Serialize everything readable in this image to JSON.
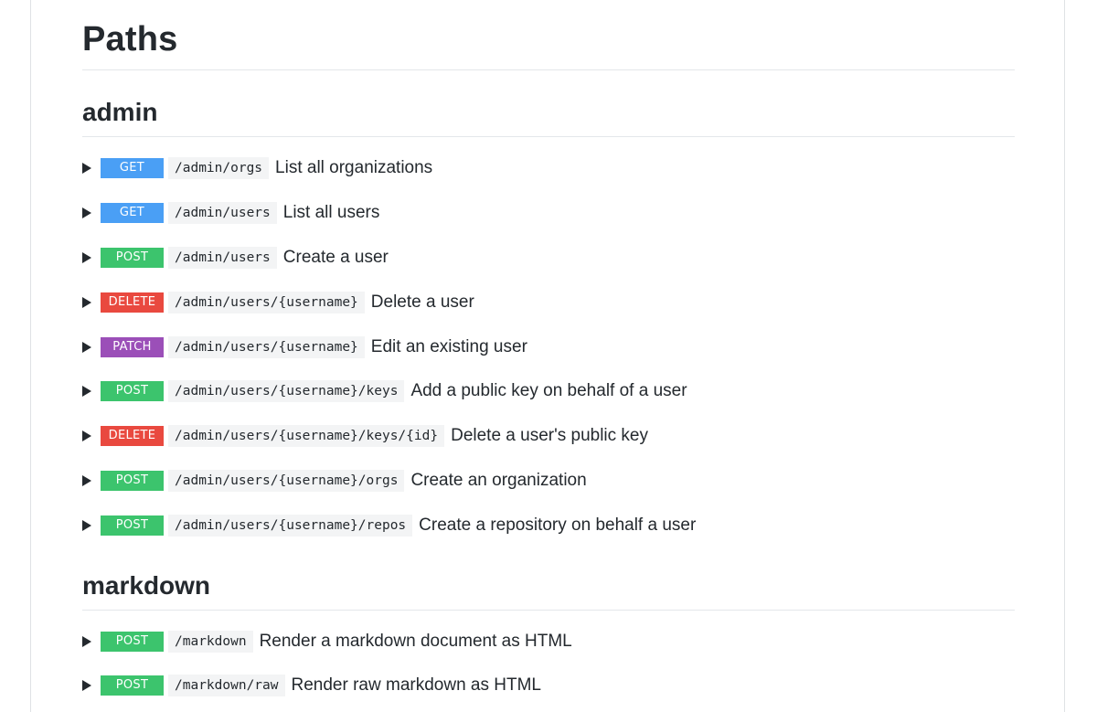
{
  "page": {
    "title": "Paths"
  },
  "sections": [
    {
      "title": "admin",
      "operations": [
        {
          "method": "GET",
          "path": "/admin/orgs",
          "summary": "List all organizations"
        },
        {
          "method": "GET",
          "path": "/admin/users",
          "summary": "List all users"
        },
        {
          "method": "POST",
          "path": "/admin/users",
          "summary": "Create a user"
        },
        {
          "method": "DELETE",
          "path": "/admin/users/{username}",
          "summary": "Delete a user"
        },
        {
          "method": "PATCH",
          "path": "/admin/users/{username}",
          "summary": "Edit an existing user"
        },
        {
          "method": "POST",
          "path": "/admin/users/{username}/keys",
          "summary": "Add a public key on behalf of a user"
        },
        {
          "method": "DELETE",
          "path": "/admin/users/{username}/keys/{id}",
          "summary": "Delete a user's public key"
        },
        {
          "method": "POST",
          "path": "/admin/users/{username}/orgs",
          "summary": "Create an organization"
        },
        {
          "method": "POST",
          "path": "/admin/users/{username}/repos",
          "summary": "Create a repository on behalf a user"
        }
      ]
    },
    {
      "title": "markdown",
      "operations": [
        {
          "method": "POST",
          "path": "/markdown",
          "summary": "Render a markdown document as HTML"
        },
        {
          "method": "POST",
          "path": "/markdown/raw",
          "summary": "Render raw markdown as HTML"
        }
      ]
    }
  ],
  "colors": {
    "GET": "#4a9ff5",
    "POST": "#3cc46d",
    "DELETE": "#e9493f",
    "PATCH": "#9b4fb8"
  },
  "icons": {
    "expand": "triangle-right-icon"
  }
}
